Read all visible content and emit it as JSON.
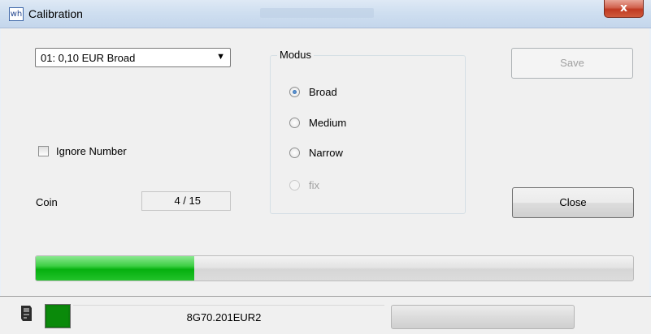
{
  "window": {
    "title": "Calibration",
    "app_icon": "wh",
    "close_glyph": "x"
  },
  "coin_select": {
    "value": "01: 0,10 EUR Broad",
    "arrow": "▼"
  },
  "modus": {
    "label": "Modus",
    "options": [
      {
        "label": "Broad",
        "checked": true,
        "enabled": true
      },
      {
        "label": "Medium",
        "checked": false,
        "enabled": true
      },
      {
        "label": "Narrow",
        "checked": false,
        "enabled": true
      },
      {
        "label": "fix",
        "checked": false,
        "enabled": false
      }
    ]
  },
  "ignore_number": {
    "label": "Ignore Number",
    "checked": false
  },
  "coin": {
    "label": "Coin",
    "value": "4 / 15",
    "progress": 0.265
  },
  "buttons": {
    "save": "Save",
    "save_enabled": false,
    "close": "Close"
  },
  "status": {
    "text": "8G70.201EUR2",
    "led_color": "#0b7e0b",
    "icon": "device-icon"
  }
}
